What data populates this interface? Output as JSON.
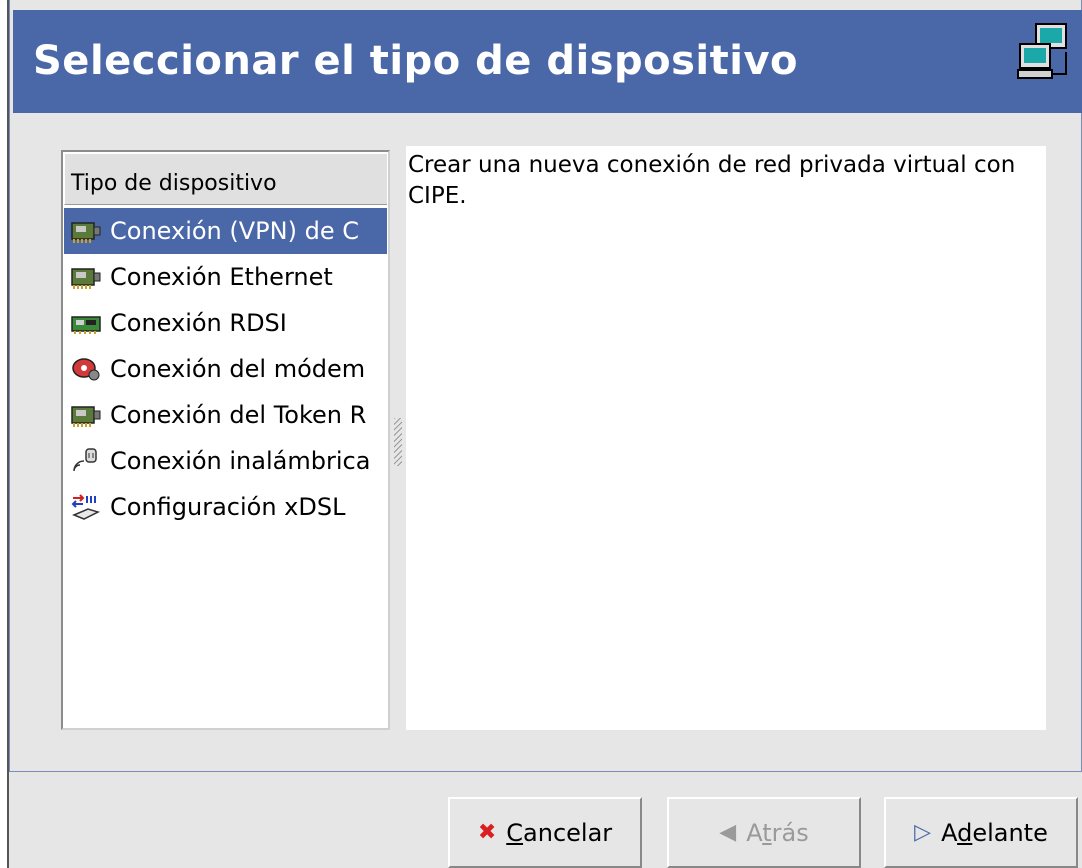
{
  "header": {
    "title": "Seleccionar el tipo de dispositivo",
    "icon": "network-computers-icon"
  },
  "device_list": {
    "column_header": "Tipo de dispositivo",
    "items": [
      {
        "label": "Conexión (VPN) de C",
        "icon": "network-card-icon",
        "selected": true
      },
      {
        "label": "Conexión Ethernet",
        "icon": "network-card-icon",
        "selected": false
      },
      {
        "label": "Conexión RDSI",
        "icon": "isdn-card-icon",
        "selected": false
      },
      {
        "label": "Conexión del módem",
        "icon": "modem-icon",
        "selected": false
      },
      {
        "label": "Conexión del Token R",
        "icon": "network-card-icon",
        "selected": false
      },
      {
        "label": "Conexión inalámbrica",
        "icon": "wireless-icon",
        "selected": false
      },
      {
        "label": "Configuración xDSL",
        "icon": "xdsl-icon",
        "selected": false
      }
    ]
  },
  "description": {
    "text": "Crear una nueva conexión de red privada virtual con CIPE."
  },
  "buttons": {
    "cancel": {
      "label": "Cancelar",
      "mnemonic": "C",
      "rest": "ancelar"
    },
    "back": {
      "prefix": "A",
      "mnemonic": "t",
      "rest": "rás"
    },
    "forward": {
      "prefix": "A",
      "mnemonic": "d",
      "rest": "elante"
    }
  },
  "colors": {
    "accent": "#4a67a8",
    "selected_text": "#ffffff"
  }
}
